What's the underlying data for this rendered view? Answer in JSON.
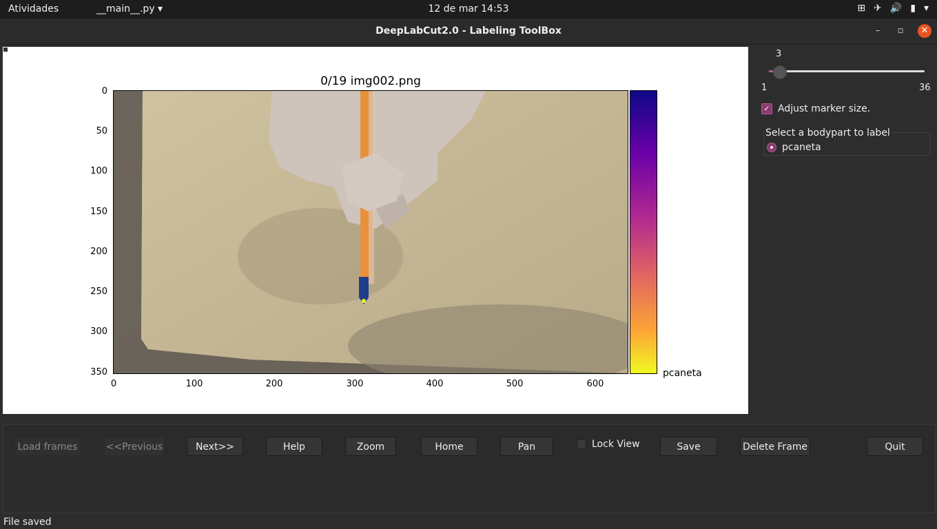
{
  "topbar": {
    "activities": "Atividades",
    "app_menu": "__main__.py ▾",
    "clock": "12 de mar  14:53",
    "tray_icons": [
      "network-icon",
      "airplane-icon",
      "volume-icon",
      "battery-icon",
      "menu-arrow-icon"
    ]
  },
  "window": {
    "title": "DeepLabCut2.0 - Labeling ToolBox",
    "minimize": "–",
    "maximize": "▫",
    "close": "✕"
  },
  "plot": {
    "title": "0/19 img002.png",
    "yticks": [
      "0",
      "50",
      "100",
      "150",
      "200",
      "250",
      "300",
      "350"
    ],
    "xticks": [
      "0",
      "100",
      "200",
      "300",
      "400",
      "500",
      "600"
    ],
    "colorbar_label": "pcaneta"
  },
  "right_panel": {
    "slider_value": "3",
    "slider_min": "1",
    "slider_max": "36",
    "adjust_marker_label": "Adjust marker size.",
    "group_title": "Select a bodypart to label",
    "bodypart": "pcaneta"
  },
  "buttons": {
    "load_frames": "Load frames",
    "previous": "<<Previous",
    "next": "Next>>",
    "help": "Help",
    "zoom": "Zoom",
    "home": "Home",
    "pan": "Pan",
    "lock_view": "Lock View",
    "save": "Save",
    "delete_frame": "Delete Frame",
    "quit": "Quit"
  },
  "status": "File saved"
}
